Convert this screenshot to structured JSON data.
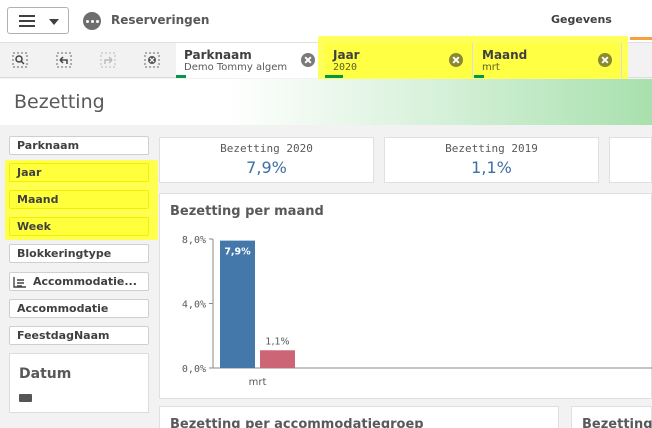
{
  "nav": {
    "app_title": "Reserveringen",
    "data_tab": "Gegevens"
  },
  "selections": [
    {
      "name": "Parknaam",
      "value": "Demo Tommy algem"
    },
    {
      "name": "Jaar",
      "value": "2020"
    },
    {
      "name": "Maand",
      "value": "mrt"
    }
  ],
  "sheet": {
    "title": "Bezetting"
  },
  "filters": [
    {
      "label": "Parknaam",
      "highlight": false
    },
    {
      "label": "Jaar",
      "highlight": true
    },
    {
      "label": "Maand",
      "highlight": true
    },
    {
      "label": "Week",
      "highlight": true
    },
    {
      "label": "Blokkeringtype",
      "highlight": false
    },
    {
      "label": "Accommodatie...",
      "highlight": false,
      "icon": "drill-down-icon"
    },
    {
      "label": "Accommodatie",
      "highlight": false
    },
    {
      "label": "FeestdagNaam",
      "highlight": false
    }
  ],
  "datum": {
    "label": "Datum"
  },
  "kpis": [
    {
      "title": "Bezetting 2020",
      "value": "7,9%"
    },
    {
      "title": "Bezetting 2019",
      "value": "1,1%"
    }
  ],
  "chart": {
    "title": "Bezetting per maand"
  },
  "chart_data": {
    "type": "bar",
    "categories": [
      "mrt"
    ],
    "series": [
      {
        "values": [
          7.9
        ],
        "labels": [
          "7,9%"
        ],
        "color": "#4477aa"
      },
      {
        "values": [
          1.1
        ],
        "labels": [
          "1,1%"
        ],
        "color": "#cc6677"
      }
    ],
    "yticks": [
      "0,0%",
      "4,0%",
      "8,0%"
    ],
    "ylim": [
      0,
      8
    ],
    "grid": false
  },
  "bottom_panels": [
    {
      "title": "Bezetting per accommodatiegroep"
    },
    {
      "title": "Bezetting"
    }
  ],
  "colors": {
    "selection_green": "#009845",
    "highlight": "#ffff44",
    "kpi_value": "#3d6fa3"
  }
}
